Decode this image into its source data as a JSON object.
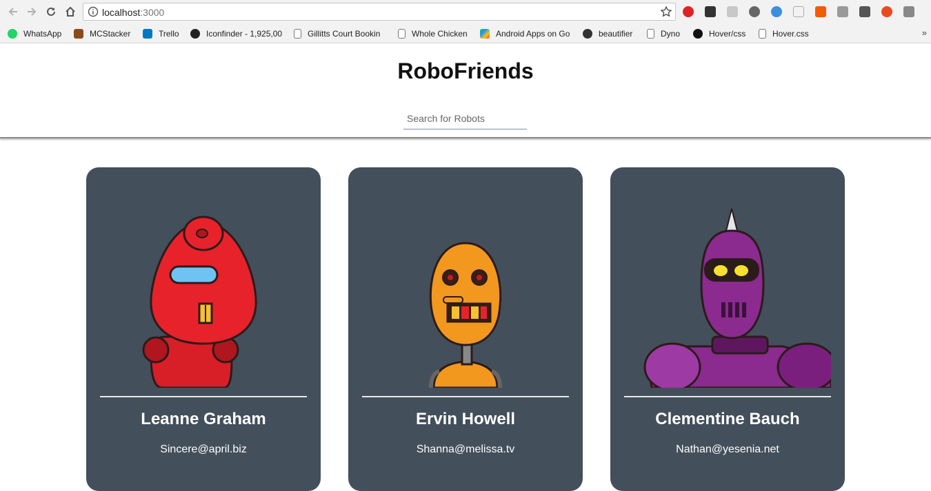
{
  "browser": {
    "url_host": "localhost",
    "url_port": ":3000",
    "bookmarks": [
      {
        "label": "WhatsApp",
        "icon": "whatsapp-icon",
        "color": "#25d366"
      },
      {
        "label": "MCStacker",
        "icon": "mcstacker-icon",
        "color": "#8b4a1c"
      },
      {
        "label": "Trello",
        "icon": "trello-icon",
        "color": "#0079bf"
      },
      {
        "label": "Iconfinder - 1,925,00",
        "icon": "iconfinder-icon",
        "color": "#222222"
      },
      {
        "label": "Gillitts Court Bookin",
        "icon": "page-icon",
        "color": "#ffffff"
      },
      {
        "label": "Whole Chicken",
        "icon": "page-icon",
        "color": "#ffffff"
      },
      {
        "label": "Android Apps on Go",
        "icon": "google-play-icon",
        "color": "#00c853"
      },
      {
        "label": "beautifier",
        "icon": "beautifier-icon",
        "color": "#333333"
      },
      {
        "label": "Dyno",
        "icon": "page-icon",
        "color": "#ffffff"
      },
      {
        "label": "Hover/css",
        "icon": "github-icon",
        "color": "#111111"
      },
      {
        "label": "Hover.css",
        "icon": "page-icon",
        "color": "#ffffff"
      }
    ],
    "more": "»"
  },
  "app": {
    "title": "RoboFriends",
    "search_placeholder": "Search for Robots"
  },
  "robots": [
    {
      "name": "Leanne Graham",
      "email": "Sincere@april.biz",
      "color": "#e8222b"
    },
    {
      "name": "Ervin Howell",
      "email": "Shanna@melissa.tv",
      "color": "#f2981e"
    },
    {
      "name": "Clementine Bauch",
      "email": "Nathan@yesenia.net",
      "color": "#8b2a8f"
    }
  ]
}
